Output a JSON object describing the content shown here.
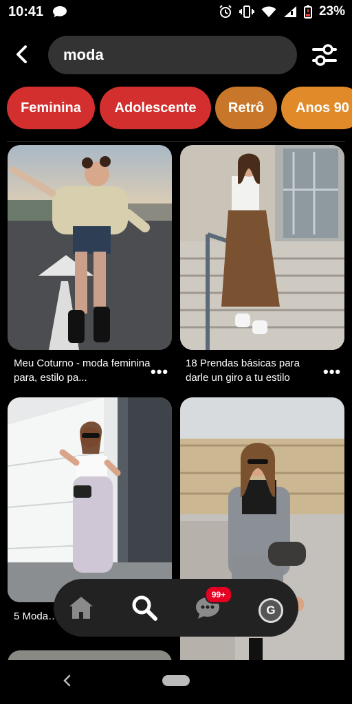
{
  "status": {
    "time": "10:41",
    "battery_text": "23%",
    "icons": [
      "chat-bubble-icon",
      "alarm-icon",
      "vibrate-icon",
      "wifi-icon",
      "signal-icon",
      "battery-icon"
    ]
  },
  "search": {
    "query": "moda"
  },
  "chips": [
    {
      "label": "Feminina",
      "color": "#d32f2f"
    },
    {
      "label": "Adolescente",
      "color": "#d32f2f"
    },
    {
      "label": "Retrô",
      "color": "#c8762a"
    },
    {
      "label": "Anos 90",
      "color": "#e08a2a"
    }
  ],
  "pins": [
    {
      "caption": "Meu Coturno - moda feminina para, estilo pa...",
      "more": "•••"
    },
    {
      "caption": "18 Prendas básicas para darle un giro a tu estilo",
      "more": "•••"
    },
    {
      "caption": "5 Moda… debes atr…",
      "more": ""
    },
    {
      "caption": "",
      "more": ""
    }
  ],
  "nav": {
    "badge": "99+",
    "avatar_initial": "G"
  }
}
